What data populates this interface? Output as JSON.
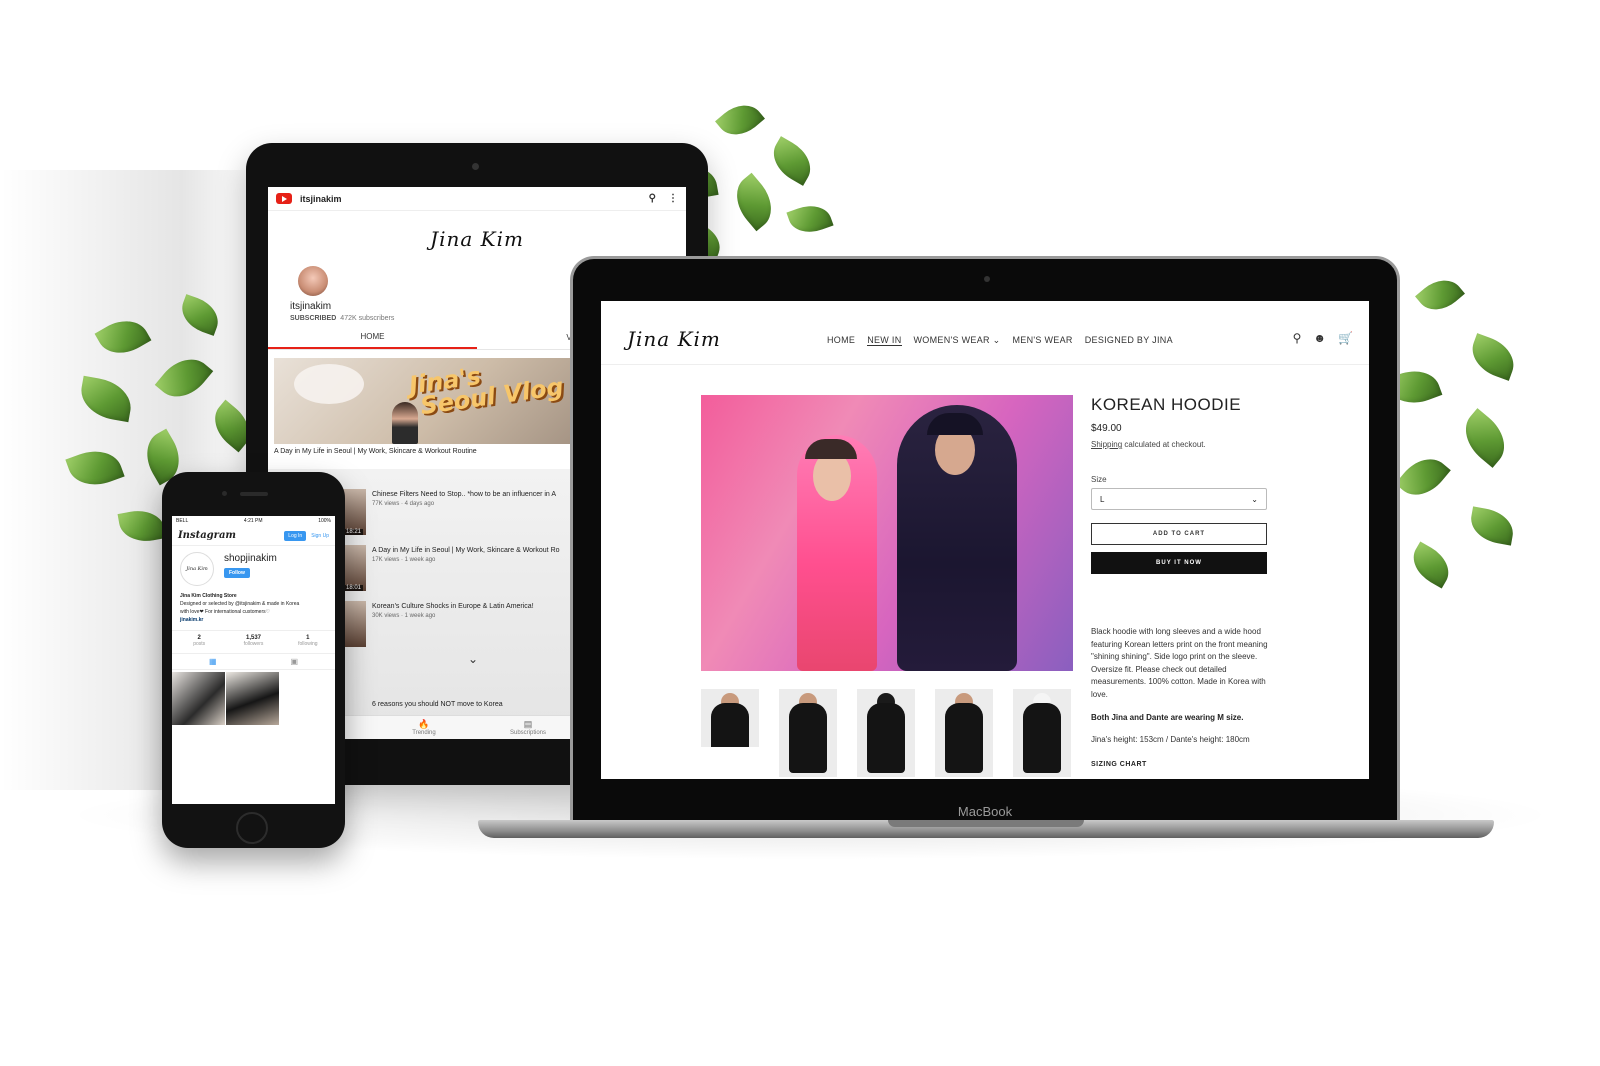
{
  "tablet": {
    "app_title": "itsjinakim",
    "banner_logo": "Jina Kim",
    "channel_name": "itsjinakim",
    "subscribed_label": "SUBSCRIBED",
    "subscribers": "472K subscribers",
    "tabs": [
      {
        "label": "HOME"
      },
      {
        "label": "VIDEOS"
      }
    ],
    "featured": {
      "overlay_text": "Jina's\n Seoul Vlog",
      "title": "A Day in My Life in Seoul | My Work, Skincare & Workout Routine"
    },
    "videos": [
      {
        "title": "Chinese Filters Need to Stop.. *how to be an influencer in A",
        "meta": "77K views · 4 days ago",
        "duration": "18:21"
      },
      {
        "title": "A Day in My Life in Seoul | My Work, Skincare & Workout Ro",
        "meta": "17K views · 1 week ago",
        "duration": "18:01"
      },
      {
        "title": "Korean's Culture Shocks in Europe & Latin America!",
        "meta": "30K views · 1 week ago",
        "duration": ""
      }
    ],
    "last_video_title": "6 reasons you should NOT move to Korea",
    "bottom_nav": [
      {
        "label": "Trending"
      },
      {
        "label": "Subscriptions"
      }
    ]
  },
  "phone": {
    "status_carrier": "BELL",
    "status_time": "4:21 PM",
    "status_battery": "100%",
    "app_logo": "Instagram",
    "login_label": "Log In",
    "signup_label": "Sign Up",
    "avatar_text": "Jina Kim",
    "username": "shopjinakim",
    "follow_label": "Follow",
    "bio_name": "Jina Kim Clothing Store",
    "bio_line1": "Designed or selected by @itsjinakim & made in Korea",
    "bio_line2": "with love❤ For international customers♡",
    "bio_link": "jinakim.kr",
    "stats": [
      {
        "value": "2",
        "label": "posts"
      },
      {
        "value": "1,537",
        "label": "followers"
      },
      {
        "value": "1",
        "label": "following"
      }
    ]
  },
  "laptop": {
    "brand": "MacBook",
    "store": {
      "logo": "Jina Kim",
      "nav": [
        {
          "label": "HOME"
        },
        {
          "label": "NEW IN"
        },
        {
          "label": "WOMEN'S WEAR ⌄"
        },
        {
          "label": "MEN'S WEAR"
        },
        {
          "label": "DESIGNED BY JINA"
        }
      ],
      "product": {
        "title": "KOREAN HOODIE",
        "price": "$49.00",
        "shipping_link": "Shipping",
        "shipping_rest": " calculated at checkout.",
        "size_label": "Size",
        "size_value": "L",
        "add_to_cart": "ADD TO CART",
        "buy_now": "BUY IT NOW",
        "description": "Black hoodie with long sleeves and a wide hood featuring Korean letters print on the front meaning \"shining shining\". Side logo print on the sleeve. Oversize fit. Please check out detailed measurements. 100% cotton. Made in Korea with love.",
        "models_note": "Both Jina and Dante are wearing M size.",
        "heights": "Jina's height: 153cm / Dante's height: 180cm",
        "sizing_chart": "SIZING CHART"
      }
    }
  },
  "colors": {
    "youtube_red": "#e62117",
    "instagram_blue": "#3897f0",
    "photo_pink": "#f35d9b",
    "device_black": "#111111"
  }
}
